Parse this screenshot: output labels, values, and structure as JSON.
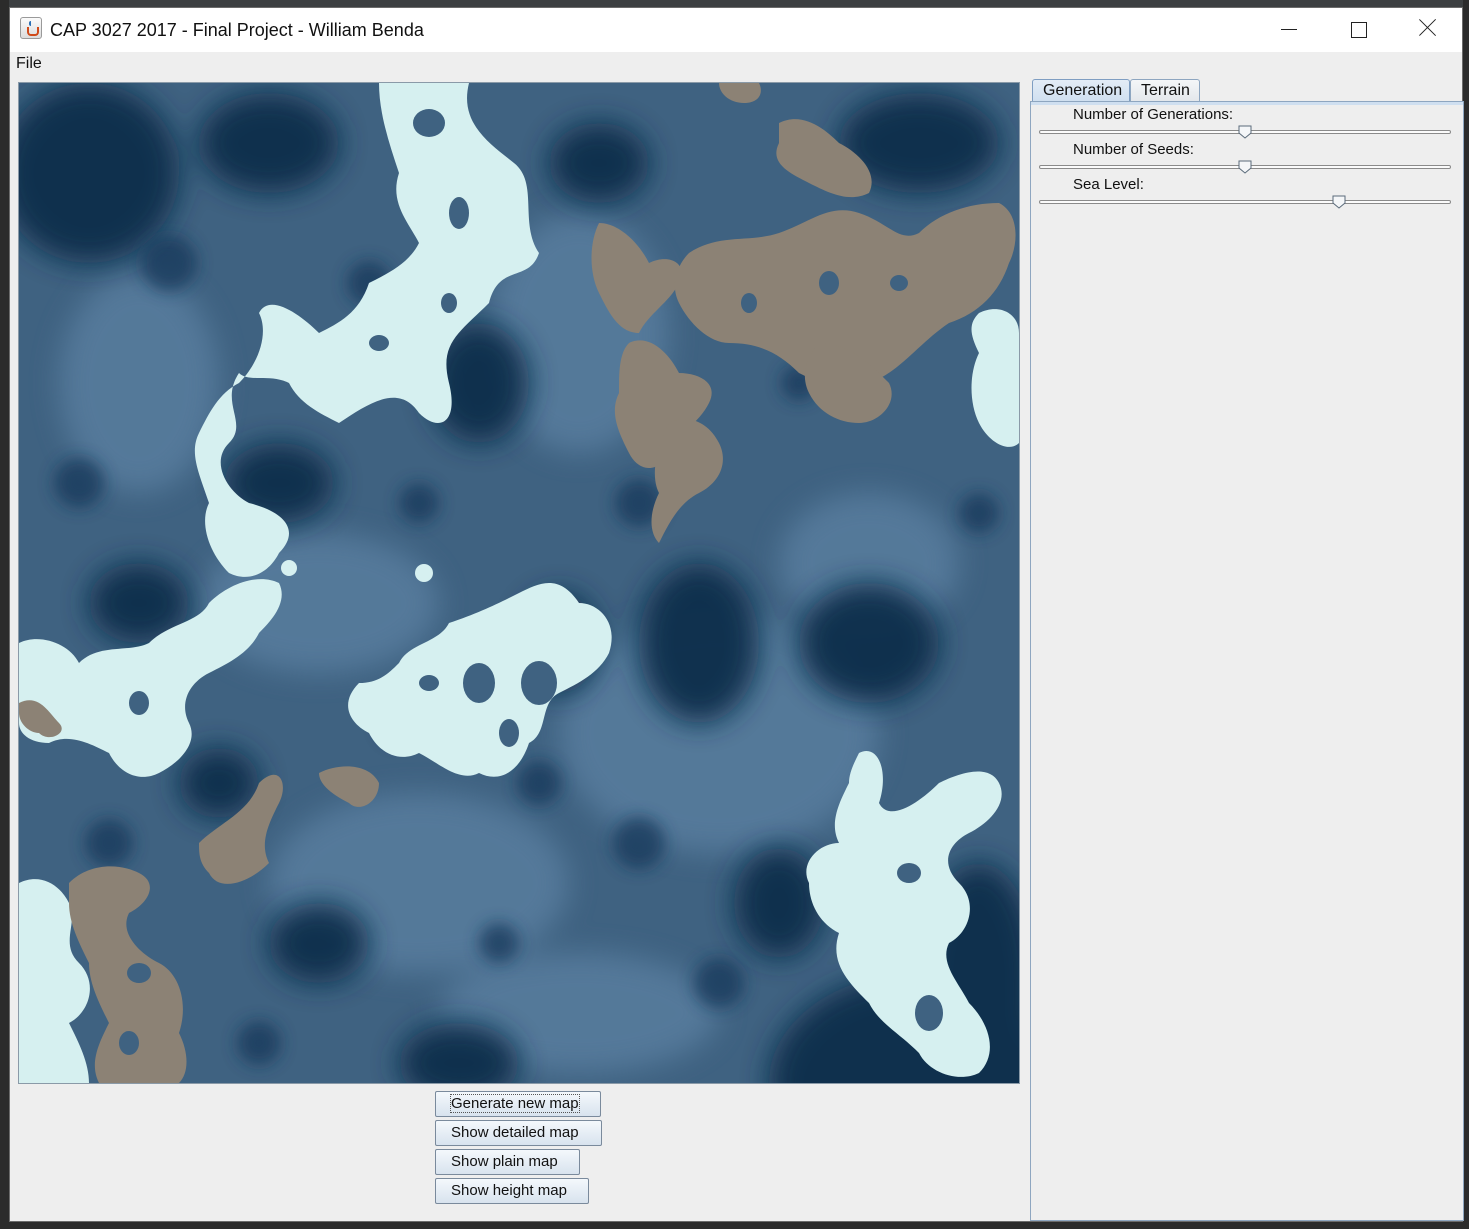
{
  "window": {
    "title": "CAP 3027 2017 - Final Project - William Benda"
  },
  "menubar": {
    "items": [
      "File"
    ]
  },
  "map": {
    "colors": {
      "deep_water": "#0e2f4b",
      "water": "#3f6281",
      "shallow_water": "#5f84a4",
      "ice": "#d6f0f0",
      "land": "#8c8275"
    }
  },
  "buttons": {
    "generate": "Generate new map",
    "detailed": "Show detailed map",
    "plain": "Show plain map",
    "height": "Show height map"
  },
  "tabs": [
    "Generation",
    "Terrain"
  ],
  "sliders": [
    {
      "label": "Number of Generations:",
      "value": 0.5
    },
    {
      "label": "Number of Seeds:",
      "value": 0.5
    },
    {
      "label": "Sea Level:",
      "value": 0.73
    }
  ]
}
